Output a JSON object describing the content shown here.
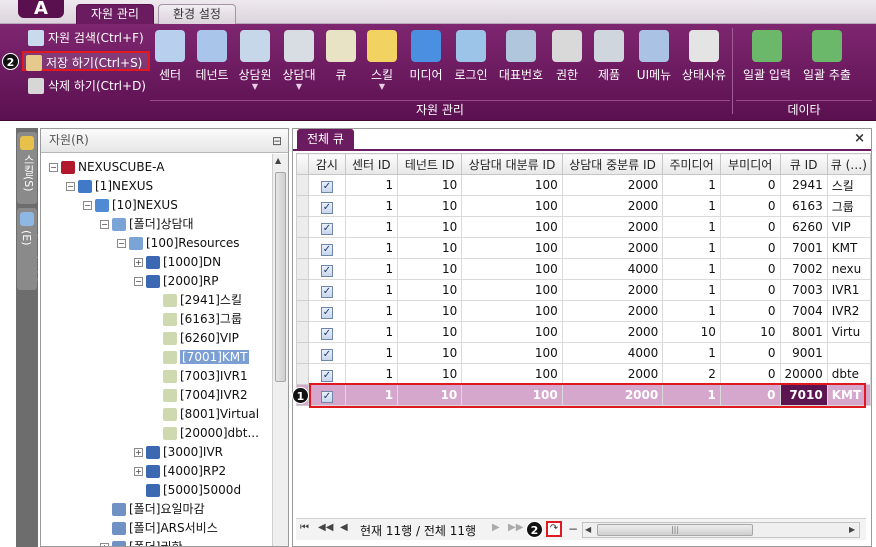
{
  "app": {
    "logo_letter": "A"
  },
  "tabs": [
    {
      "label": "자원 관리",
      "active": true
    },
    {
      "label": "환경 설정",
      "active": false
    }
  ],
  "ribbon": {
    "small_commands": [
      {
        "label": "자원 검색(Ctrl+F)"
      },
      {
        "label": "저장 하기(Ctrl+S)",
        "highlighted": true
      },
      {
        "label": "삭제 하기(Ctrl+D)"
      }
    ],
    "big_buttons": [
      {
        "label": "센터",
        "icon": "building-icon",
        "color": "#b8d0ee"
      },
      {
        "label": "테넌트",
        "icon": "tenant-icon",
        "color": "#a9c6ea"
      },
      {
        "label": "상담원",
        "icon": "agent-icon",
        "color": "#c7d7ea",
        "dropdown": true
      },
      {
        "label": "상담대",
        "icon": "desk-icon",
        "color": "#d8dde4",
        "dropdown": true
      },
      {
        "label": "큐",
        "icon": "queue-icon",
        "color": "#e8e3c4"
      },
      {
        "label": "스킬",
        "icon": "skill-icon",
        "color": "#f2d261",
        "dropdown": true
      },
      {
        "label": "미디어",
        "icon": "media-icon",
        "color": "#4b8fe0"
      },
      {
        "label": "로그인",
        "icon": "login-icon",
        "color": "#9cc3e8"
      },
      {
        "label": "대표번호",
        "icon": "rep-number-icon",
        "color": "#b0c6dc"
      },
      {
        "label": "권한",
        "icon": "lock-icon",
        "color": "#d9d9d9"
      },
      {
        "label": "제품",
        "icon": "product-icon",
        "color": "#cfd6de"
      },
      {
        "label": "UI메뉴",
        "icon": "ui-menu-icon",
        "color": "#aac3e4"
      },
      {
        "label": "상태사유",
        "icon": "status-reason-icon",
        "color": "#e4e4e4"
      },
      {
        "label": "일괄 입력",
        "icon": "excel-import-icon",
        "color": "#6cb86a"
      },
      {
        "label": "일괄 추출",
        "icon": "excel-export-icon",
        "color": "#6cb86a"
      }
    ],
    "group_labels": [
      "자원 관리",
      "데이타"
    ]
  },
  "side_tabs": [
    "스킬(S)",
    "상담원그룹(E)"
  ],
  "tree": {
    "header": "자원(R)",
    "nodes": [
      {
        "label": "NEXUSCUBE-A",
        "depth": 0,
        "exp": "−",
        "icon": "#b2182b"
      },
      {
        "label": "[1]NEXUS",
        "depth": 1,
        "exp": "−",
        "icon": "#3f79c8"
      },
      {
        "label": "[10]NEXUS",
        "depth": 2,
        "exp": "−",
        "icon": "#4f8ad2"
      },
      {
        "label": "[폴더]상담대",
        "depth": 3,
        "exp": "−",
        "icon": "#7aa3d6"
      },
      {
        "label": "[100]Resources",
        "depth": 4,
        "exp": "−",
        "icon": "#7aa3d6"
      },
      {
        "label": "[1000]DN",
        "depth": 5,
        "exp": "+",
        "icon": "#3b68b0"
      },
      {
        "label": "[2000]RP",
        "depth": 5,
        "exp": "−",
        "icon": "#3b68b0"
      },
      {
        "label": "[2941]스킬",
        "depth": 6,
        "exp": "",
        "icon": "#cfd9b0"
      },
      {
        "label": "[6163]그룹",
        "depth": 6,
        "exp": "",
        "icon": "#cfd9b0"
      },
      {
        "label": "[6260]VIP",
        "depth": 6,
        "exp": "",
        "icon": "#cfd9b0"
      },
      {
        "label": "[7001]KMT",
        "depth": 6,
        "exp": "",
        "icon": "#cfd9b0",
        "selected": true
      },
      {
        "label": "[7003]IVR1",
        "depth": 6,
        "exp": "",
        "icon": "#cfd9b0"
      },
      {
        "label": "[7004]IVR2",
        "depth": 6,
        "exp": "",
        "icon": "#cfd9b0"
      },
      {
        "label": "[8001]Virtual",
        "depth": 6,
        "exp": "",
        "icon": "#cfd9b0"
      },
      {
        "label": "[20000]dbt...",
        "depth": 6,
        "exp": "",
        "icon": "#cfd9b0"
      },
      {
        "label": "[3000]IVR",
        "depth": 5,
        "exp": "+",
        "icon": "#3b68b0"
      },
      {
        "label": "[4000]RP2",
        "depth": 5,
        "exp": "+",
        "icon": "#3b68b0"
      },
      {
        "label": "[5000]5000d",
        "depth": 5,
        "exp": "",
        "icon": "#3b68b0"
      },
      {
        "label": "[폴더]요일마감",
        "depth": 3,
        "exp": "",
        "icon": "#6f91c4"
      },
      {
        "label": "[폴더]ARS서비스",
        "depth": 3,
        "exp": "",
        "icon": "#6f91c4"
      },
      {
        "label": "[폴더]권한",
        "depth": 3,
        "exp": "+",
        "icon": "#6f91c4"
      }
    ]
  },
  "grid": {
    "tab_label": "전체 큐",
    "columns": [
      "감시",
      "센터 ID",
      "테넌트 ID",
      "상담대 대분류 ID",
      "상담대 중분류 ID",
      "주미디어",
      "부미디어",
      "큐 ID",
      "큐 (…)"
    ],
    "rows": [
      {
        "monitor": true,
        "center": "1",
        "tenant": "10",
        "big": "100",
        "mid": "2000",
        "main": "1",
        "sub": "0",
        "qid": "2941",
        "qname": "스킬"
      },
      {
        "monitor": true,
        "center": "1",
        "tenant": "10",
        "big": "100",
        "mid": "2000",
        "main": "1",
        "sub": "0",
        "qid": "6163",
        "qname": "그룹"
      },
      {
        "monitor": true,
        "center": "1",
        "tenant": "10",
        "big": "100",
        "mid": "2000",
        "main": "1",
        "sub": "0",
        "qid": "6260",
        "qname": "VIP"
      },
      {
        "monitor": true,
        "center": "1",
        "tenant": "10",
        "big": "100",
        "mid": "2000",
        "main": "1",
        "sub": "0",
        "qid": "7001",
        "qname": "KMT"
      },
      {
        "monitor": true,
        "center": "1",
        "tenant": "10",
        "big": "100",
        "mid": "4000",
        "main": "1",
        "sub": "0",
        "qid": "7002",
        "qname": "nexu"
      },
      {
        "monitor": true,
        "center": "1",
        "tenant": "10",
        "big": "100",
        "mid": "2000",
        "main": "1",
        "sub": "0",
        "qid": "7003",
        "qname": "IVR1"
      },
      {
        "monitor": true,
        "center": "1",
        "tenant": "10",
        "big": "100",
        "mid": "2000",
        "main": "1",
        "sub": "0",
        "qid": "7004",
        "qname": "IVR2"
      },
      {
        "monitor": true,
        "center": "1",
        "tenant": "10",
        "big": "100",
        "mid": "2000",
        "main": "10",
        "sub": "10",
        "qid": "8001",
        "qname": "Virtu"
      },
      {
        "monitor": true,
        "center": "1",
        "tenant": "10",
        "big": "100",
        "mid": "4000",
        "main": "1",
        "sub": "0",
        "qid": "9001",
        "qname": ""
      },
      {
        "monitor": true,
        "center": "1",
        "tenant": "10",
        "big": "100",
        "mid": "2000",
        "main": "2",
        "sub": "0",
        "qid": "20000",
        "qname": "dbte"
      },
      {
        "monitor": true,
        "center": "1",
        "tenant": "10",
        "big": "100",
        "mid": "2000",
        "main": "1",
        "sub": "0",
        "qid": "7010",
        "qname": "KMT",
        "new": true
      }
    ]
  },
  "navigator": {
    "status": "현재 11행 / 전체 11행"
  },
  "badges": {
    "save": "2",
    "new_row": "1",
    "refresh": "2"
  },
  "colors": {
    "ribbon": "#6b1b5f",
    "highlight_red": "#e0181f",
    "new_row": "#d6a7cc"
  }
}
